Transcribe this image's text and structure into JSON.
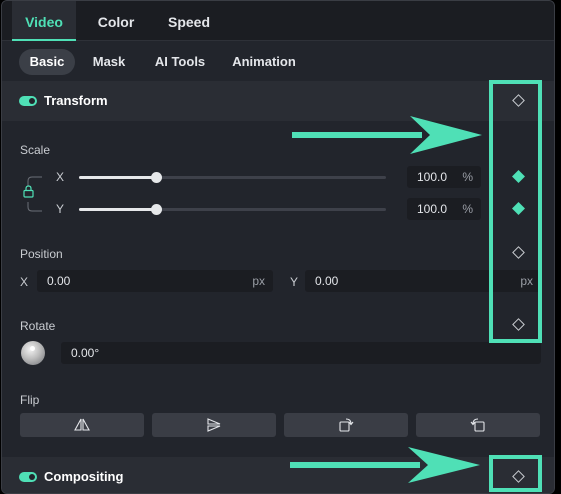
{
  "top_tabs": [
    {
      "label": "Video",
      "active": true
    },
    {
      "label": "Color",
      "active": false
    },
    {
      "label": "Speed",
      "active": false
    }
  ],
  "sub_tabs": [
    {
      "label": "Basic",
      "active": true
    },
    {
      "label": "Mask",
      "active": false
    },
    {
      "label": "AI Tools",
      "active": false
    },
    {
      "label": "Animation",
      "active": false
    }
  ],
  "transform": {
    "title": "Transform",
    "enabled": true,
    "scale": {
      "label": "Scale",
      "x_label": "X",
      "x_value": "100.0",
      "x_unit": "%",
      "y_label": "Y",
      "y_value": "100.0",
      "y_unit": "%",
      "x_slider_fraction": 0.25,
      "y_slider_fraction": 0.25,
      "linked": true
    },
    "position": {
      "label": "Position",
      "x_label": "X",
      "x_value": "0.00",
      "x_unit": "px",
      "y_label": "Y",
      "y_value": "0.00",
      "y_unit": "px"
    },
    "rotate": {
      "label": "Rotate",
      "value": "0.00°"
    },
    "flip": {
      "label": "Flip",
      "buttons": [
        "flip-horizontal-icon",
        "flip-vertical-icon",
        "rotate-clockwise-icon",
        "rotate-counterclockwise-icon"
      ]
    }
  },
  "compositing": {
    "title": "Compositing",
    "enabled": true
  },
  "keyframes": {
    "transform": "inactive",
    "scale_x": "active",
    "scale_y": "active",
    "position": "inactive",
    "rotate": "inactive",
    "compositing": "inactive"
  },
  "colors": {
    "accent": "#4fe0b6",
    "panel_bg": "#22252c",
    "header_bg": "#2a2d34"
  }
}
